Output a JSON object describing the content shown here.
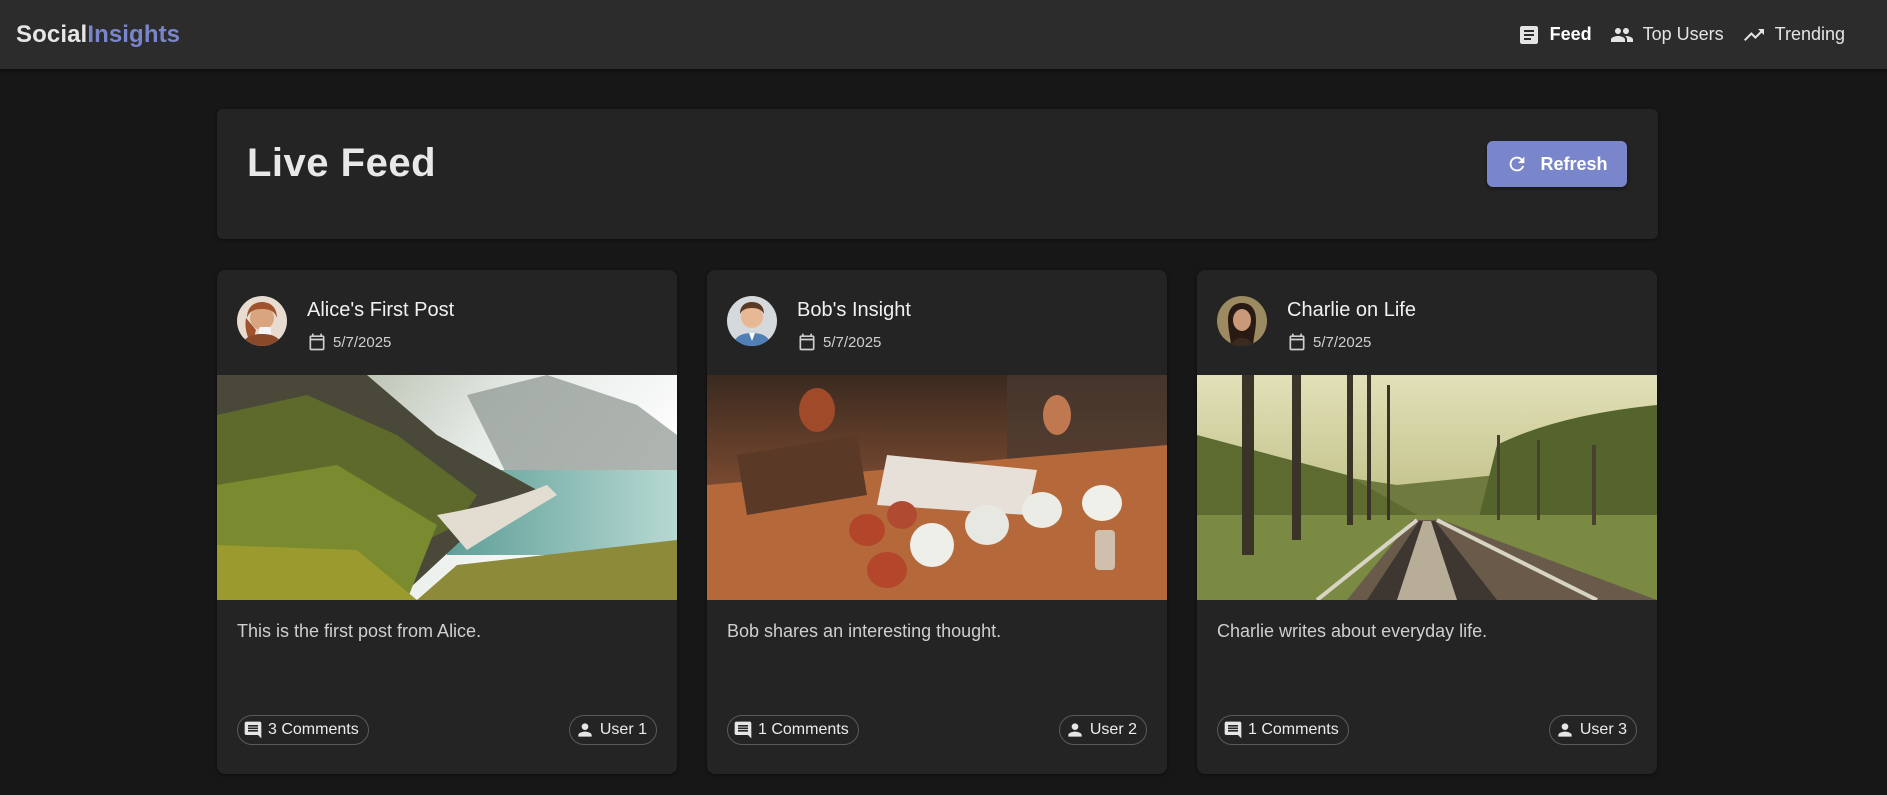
{
  "brand": {
    "part1": "Social",
    "part2": "Insights"
  },
  "nav": [
    {
      "label": "Feed",
      "icon": "article-icon",
      "active": true
    },
    {
      "label": "Top Users",
      "icon": "people-icon",
      "active": false
    },
    {
      "label": "Trending",
      "icon": "trending-up-icon",
      "active": false
    }
  ],
  "header": {
    "title": "Live Feed",
    "refresh_label": "Refresh"
  },
  "posts": [
    {
      "title": "Alice's First Post",
      "date": "5/7/2025",
      "body": "This is the first post from Alice.",
      "comments": "3 Comments",
      "user": "User 1",
      "image_subject": "mountain-beach-landscape"
    },
    {
      "title": "Bob's Insight",
      "date": "5/7/2025",
      "body": "Bob shares an interesting thought.",
      "comments": "1 Comments",
      "user": "User 2",
      "image_subject": "cups-on-wooden-table"
    },
    {
      "title": "Charlie on Life",
      "date": "5/7/2025",
      "body": "Charlie writes about everyday life.",
      "comments": "1 Comments",
      "user": "User 3",
      "image_subject": "railway-tracks-forest"
    }
  ],
  "colors": {
    "accent": "#7986cb",
    "appbar": "#2c2c2c",
    "background": "#171717",
    "card": "#242424"
  }
}
